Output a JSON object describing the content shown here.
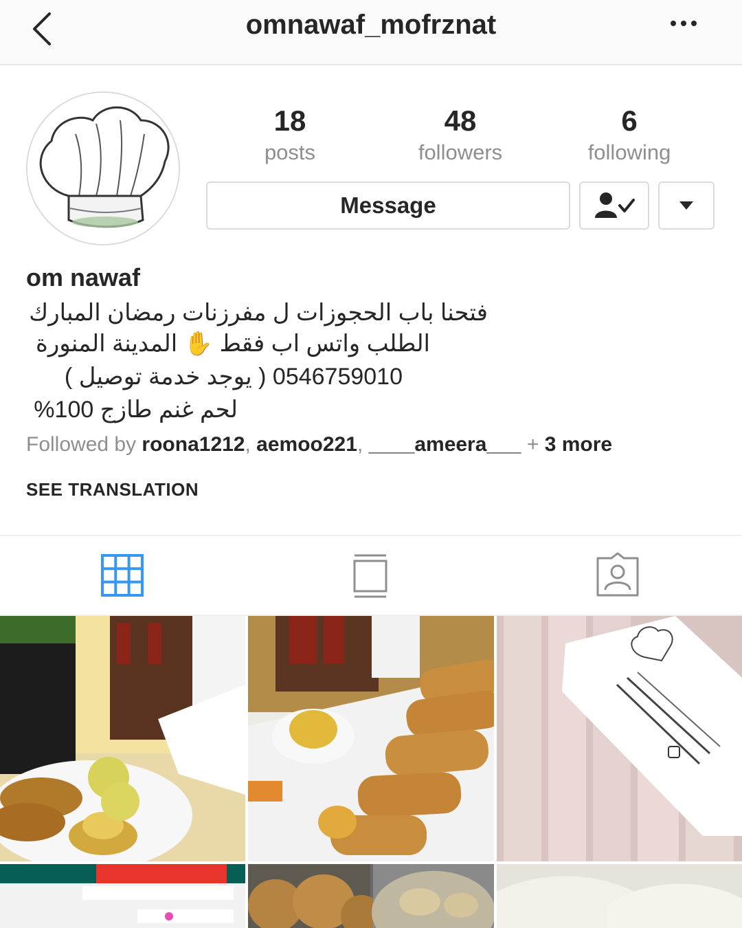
{
  "header": {
    "username": "omnawaf_mofrznat",
    "back_icon": "chevron-left-icon",
    "more_icon": "more-horizontal-icon"
  },
  "profile": {
    "avatar_icon": "chef-hat-icon",
    "stats": {
      "posts": {
        "count": "18",
        "label": "posts"
      },
      "followers": {
        "count": "48",
        "label": "followers"
      },
      "following": {
        "count": "6",
        "label": "following"
      }
    },
    "buttons": {
      "message": "Message",
      "following_icon": "person-check-icon",
      "dropdown_icon": "triangle-down-icon"
    },
    "full_name": "om nawaf",
    "bio_lines": [
      "فتحنا باب الحجوزات ل مفرزنات رمضان المبارك",
      "الطلب واتس اب فقط ✋ المدينة المنورة",
      "0546759010 ( يوجد خدمة توصيل )",
      "لحم غنم طازج 100%"
    ],
    "followed_by": {
      "prefix": "Followed by",
      "users": [
        "roona1212",
        "aemoo221",
        "____ameera___"
      ],
      "more": "3 more"
    },
    "see_translation": "SEE TRANSLATION"
  },
  "tabs": [
    {
      "name": "grid",
      "icon": "grid-icon",
      "active": true
    },
    {
      "name": "feed",
      "icon": "feed-icon",
      "active": false
    },
    {
      "name": "tagged",
      "icon": "tagged-person-icon",
      "active": false
    }
  ],
  "colors": {
    "active_tab": "#3897f0",
    "text": "#262626",
    "secondary": "#8e8e8e",
    "border": "#dbdbdb"
  }
}
